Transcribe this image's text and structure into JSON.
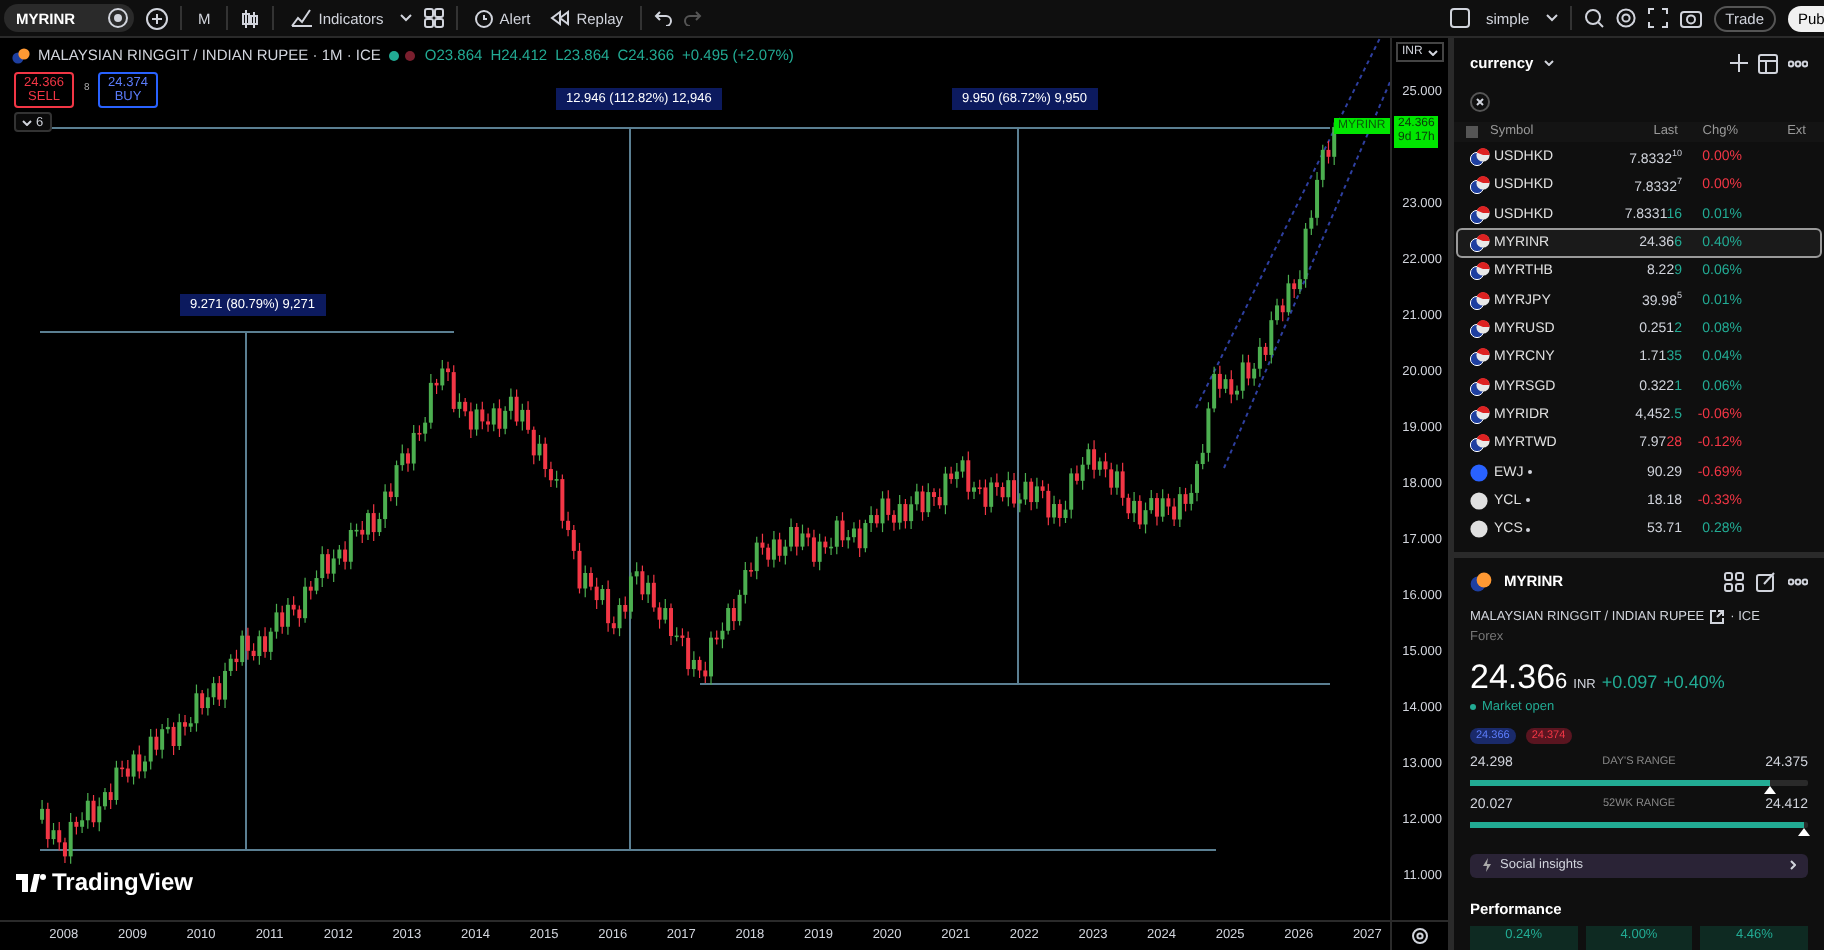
{
  "toolbar": {
    "symbol": "MYRINR",
    "interval": "M",
    "indicators": "Indicators",
    "alert": "Alert",
    "replay": "Replay",
    "layout": "simple",
    "trade": "Trade",
    "publish": "Pub"
  },
  "chart": {
    "legend": {
      "title": "MALAYSIAN RINGGIT / INDIAN RUPEE · 1M · ICE",
      "ohlc": [
        "O23.864",
        "H24.412",
        "L23.864",
        "C24.366"
      ],
      "change": "+0.495 (+2.07%)"
    },
    "sell": {
      "price": "24.366",
      "label": "SELL"
    },
    "spread": "8",
    "buy": {
      "price": "24.374",
      "label": "BUY"
    },
    "indicators_count": "6",
    "measures": [
      {
        "label": "9.271 (80.79%) 9,271"
      },
      {
        "label": "12.946 (112.82%) 12,946"
      },
      {
        "label": "9.950 (68.72%) 9,950"
      }
    ],
    "last_price": {
      "symbol": "MYRINR",
      "price": "24.366",
      "countdown": "9d 17h"
    },
    "currency": "INR",
    "logo": "TradingView",
    "price_axis": [
      "25.000",
      "23.000",
      "22.000",
      "21.000",
      "20.000",
      "19.000",
      "18.000",
      "17.000",
      "16.000",
      "15.000",
      "14.000",
      "13.000",
      "12.000",
      "11.000"
    ],
    "time_axis": [
      "2008",
      "2009",
      "2010",
      "2011",
      "2012",
      "2013",
      "2014",
      "2015",
      "2016",
      "2017",
      "2018",
      "2019",
      "2020",
      "2021",
      "2022",
      "2023",
      "2024",
      "2025",
      "2026",
      "2027"
    ]
  },
  "watchlist": {
    "title": "currency",
    "columns": [
      "Symbol",
      "Last",
      "Chg%",
      "Ext"
    ],
    "rows": [
      {
        "kind": "pair",
        "symbol": "USDHKD",
        "last": "7.8332$^{10}$",
        "change": "0.00%",
        "up": false,
        "closed": false,
        "selected": false
      },
      {
        "kind": "pair",
        "symbol": "USDHKD",
        "last": "7.8332$^{7}$",
        "change": "0.00%",
        "up": false,
        "closed": false,
        "selected": false
      },
      {
        "kind": "pair",
        "symbol": "USDHKD",
        "last": "7.8331",
        "tick": "16",
        "tick_up": true,
        "change": "0.01%",
        "up": true,
        "closed": false,
        "selected": false
      },
      {
        "kind": "pair",
        "symbol": "MYRINR",
        "last": "24.36",
        "tick": "6",
        "tick_up": true,
        "change": "0.40%",
        "up": true,
        "closed": false,
        "selected": true
      },
      {
        "kind": "pair",
        "symbol": "MYRTHB",
        "last": "8.22",
        "tick": "9",
        "tick_up": true,
        "change": "0.06%",
        "up": true,
        "closed": false,
        "selected": false
      },
      {
        "kind": "pair",
        "symbol": "MYRJPY",
        "last": "39.98$^{5}$",
        "change": "0.01%",
        "up": true,
        "closed": false,
        "selected": false
      },
      {
        "kind": "pair",
        "symbol": "MYRUSD",
        "last": "0.251",
        "tick": "2",
        "tick_up": true,
        "change": "0.08%",
        "up": true,
        "closed": false,
        "selected": false
      },
      {
        "kind": "pair",
        "symbol": "MYRCNY",
        "last": "1.71",
        "tick": "35",
        "tick_up": true,
        "change": "0.04%",
        "up": true,
        "closed": false,
        "selected": false
      },
      {
        "kind": "pair",
        "symbol": "MYRSGD",
        "last": "0.322",
        "tick": "1",
        "tick_up": true,
        "change": "0.06%",
        "up": true,
        "closed": false,
        "selected": false
      },
      {
        "kind": "pair",
        "symbol": "MYRIDR",
        "last": "4,452",
        "tick": ".5",
        "tick_up": true,
        "change": "-0.06%",
        "up": false,
        "closed": false,
        "selected": false
      },
      {
        "kind": "pair",
        "symbol": "MYRTWD",
        "last": "7.97",
        "tick": "28",
        "tick_up": false,
        "change": "-0.12%",
        "up": false,
        "closed": false,
        "selected": false
      },
      {
        "kind": "fund",
        "color": "#2962ff",
        "symbol": "EWJ",
        "last": "90.29",
        "change": "-0.69%",
        "up": false,
        "closed": true,
        "selected": false
      },
      {
        "kind": "fund",
        "color": "#e0e0e0",
        "symbol": "YCL",
        "last": "18.18",
        "change": "-0.33%",
        "up": false,
        "closed": true,
        "selected": false
      },
      {
        "kind": "fund",
        "color": "#e0e0e0",
        "symbol": "YCS",
        "last": "53.71",
        "change": "0.28%",
        "up": true,
        "closed": true,
        "selected": false
      }
    ]
  },
  "details": {
    "symbol": "MYRINR",
    "name": "MALAYSIAN RINGGIT / INDIAN RUPEE",
    "exchange": "· ICE",
    "category": "Forex",
    "price": "24.36",
    "price_tick": "6",
    "currency": "INR",
    "change": "+0.097",
    "change_pct": "+0.40%",
    "market_status": "Market open",
    "market_open": true,
    "bid": "24.366",
    "ask": "24.374",
    "ranges": [
      {
        "low": "24.298",
        "label": "DAY'S RANGE",
        "high": "24.375",
        "level": 0.89
      },
      {
        "low": "20.027",
        "label": "52WK RANGE",
        "high": "24.412",
        "level": 0.99
      }
    ],
    "insights": "Social insights",
    "performance_title": "Performance",
    "performance": [
      {
        "value": "0.24%"
      },
      {
        "value": "4.00%"
      },
      {
        "value": "4.46%"
      }
    ]
  }
}
